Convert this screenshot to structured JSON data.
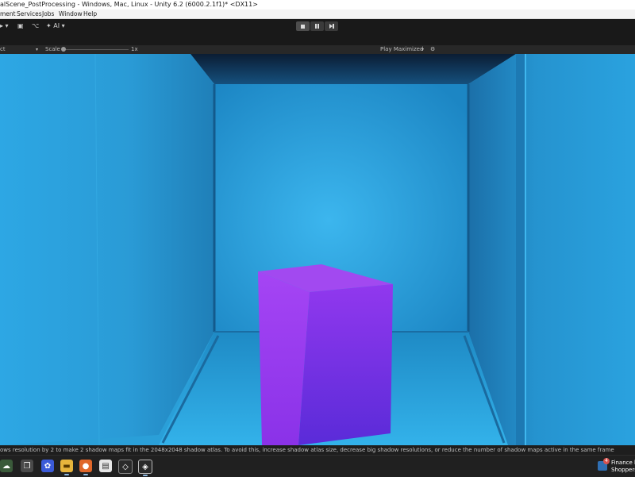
{
  "window": {
    "title": "alScene_PostProcessing - Windows, Mac, Linux - Unity 6.2 (6000.2.1f1)* <DX11>"
  },
  "menu": {
    "items": [
      "ment",
      "Services",
      "Jobs",
      "Window",
      "Help"
    ]
  },
  "toolbar": {
    "ai_label": "AI",
    "play_controls": [
      "stop",
      "pause",
      "step"
    ]
  },
  "gameview": {
    "display_label": "ct",
    "scale_label": "Scale",
    "scale_value": "1x",
    "play_mode_label": "Play Maximized",
    "scale_level": 0.0
  },
  "status": {
    "message": "ows resolution by 2 to make 2 shadow maps fit in the 2048x2048 shadow atlas. To avoid this, increase shadow atlas size, decrease big shadow resolutions, or reduce the number of shadow maps active in the same frame"
  },
  "taskbar": {
    "icons": [
      "widgets-icon",
      "task-view-icon",
      "copilot-icon",
      "file-explorer-icon",
      "firefox-icon",
      "notepad-icon",
      "unity-hub-icon",
      "unity-editor-icon"
    ],
    "news_badge": "4",
    "news_line1": "Finance h",
    "news_line2": "Shoppers"
  },
  "colors": {
    "scene_blue": "#2a9fd8",
    "cube_purple": "#9b3df0",
    "editor_dark": "#191919"
  }
}
